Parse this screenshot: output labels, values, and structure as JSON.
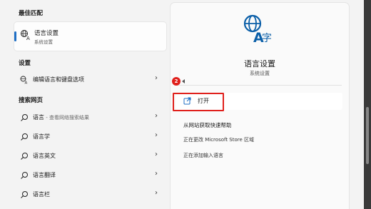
{
  "left": {
    "best_match_heading": "最佳匹配",
    "best_match": {
      "title": "语言设置",
      "subtitle": "系统设置"
    },
    "settings_heading": "设置",
    "settings_items": [
      {
        "label": "编辑语言和键盘选项"
      }
    ],
    "web_heading": "搜索网页",
    "web_items": [
      {
        "label": "语言",
        "suffix": " - 查看网络搜索结果"
      },
      {
        "label": "语言学",
        "suffix": ""
      },
      {
        "label": "语言英文",
        "suffix": ""
      },
      {
        "label": "语言翻译",
        "suffix": ""
      },
      {
        "label": "语言栏",
        "suffix": ""
      }
    ]
  },
  "right": {
    "app_title": "语言设置",
    "app_subtitle": "系统设置",
    "open_label": "打开",
    "annotation_number": "2",
    "help_title": "从网站获取快速帮助",
    "help_links": [
      "正在更改 Microsoft Store 区域",
      "正在添加输入语言"
    ]
  },
  "colors": {
    "accent": "#1f6fc5",
    "annotation": "#e0201c"
  },
  "icons": {
    "best_match": "language-settings-icon",
    "settings_item": "keyboard-language-icon",
    "web_item": "search-icon",
    "chevron": "chevron-right-icon",
    "open": "open-external-icon"
  }
}
